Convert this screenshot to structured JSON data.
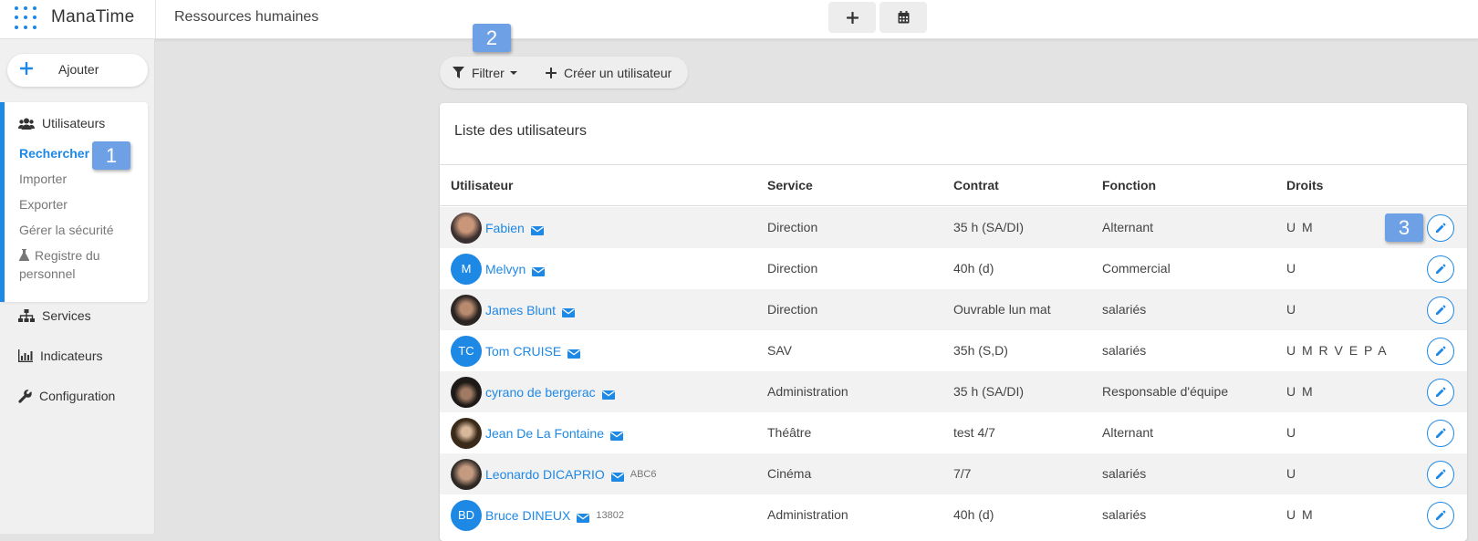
{
  "app": {
    "name": "ManaTime",
    "page_title": "Ressources humaines"
  },
  "topbar": {
    "buttons": [
      "plus-icon",
      "calendar-icon"
    ]
  },
  "sidebar": {
    "add_label": "Ajouter",
    "users_section": {
      "title": "Utilisateurs",
      "items": [
        "Rechercher",
        "Importer",
        "Exporter",
        "Gérer la sécurité"
      ],
      "registry_line1": "Registre du",
      "registry_line2": "personnel"
    },
    "nav": [
      "Services",
      "Indicateurs",
      "Configuration"
    ]
  },
  "toolbar": {
    "filter_label": "Filtrer",
    "create_label": "Créer un utilisateur"
  },
  "annotations": [
    "1",
    "2",
    "3"
  ],
  "table": {
    "title": "Liste des utilisateurs",
    "headers": [
      "Utilisateur",
      "Service",
      "Contrat",
      "Fonction",
      "Droits"
    ],
    "rows": [
      {
        "name": "Fabien",
        "avatar": "photo",
        "initials": "",
        "code": "",
        "service": "Direction",
        "contract": "35 h (SA/DI)",
        "function": "Alternant",
        "rights": "U M"
      },
      {
        "name": "Melvyn",
        "avatar": "initials",
        "initials": "M",
        "code": "",
        "service": "Direction",
        "contract": "40h (d)",
        "function": "Commercial",
        "rights": "U"
      },
      {
        "name": "James Blunt",
        "avatar": "photo",
        "initials": "",
        "code": "",
        "service": "Direction",
        "contract": "Ouvrable lun mat",
        "function": "salariés",
        "rights": "U"
      },
      {
        "name": "Tom CRUISE",
        "avatar": "initials",
        "initials": "TC",
        "code": "",
        "service": "SAV",
        "contract": "35h (S,D)",
        "function": "salariés",
        "rights": "U M R V E P A"
      },
      {
        "name": "cyrano de bergerac",
        "avatar": "photo",
        "initials": "",
        "code": "",
        "service": "Administration",
        "contract": "35 h (SA/DI)",
        "function": "Responsable d'équipe",
        "rights": "U M"
      },
      {
        "name": "Jean De La Fontaine",
        "avatar": "photo",
        "initials": "",
        "code": "",
        "service": "Théâtre",
        "contract": "test 4/7",
        "function": "Alternant",
        "rights": "U"
      },
      {
        "name": "Leonardo DICAPRIO",
        "avatar": "photo",
        "initials": "",
        "code": "ABC6",
        "service": "Cinéma",
        "contract": "7/7",
        "function": "salariés",
        "rights": "U"
      },
      {
        "name": "Bruce DINEUX",
        "avatar": "initials",
        "initials": "BD",
        "code": "13802",
        "service": "Administration",
        "contract": "40h (d)",
        "function": "salariés",
        "rights": "U M"
      }
    ]
  },
  "colors": {
    "accent": "#1e88e5",
    "badge": "#6ea0e6",
    "background": "#e3e3e3"
  }
}
